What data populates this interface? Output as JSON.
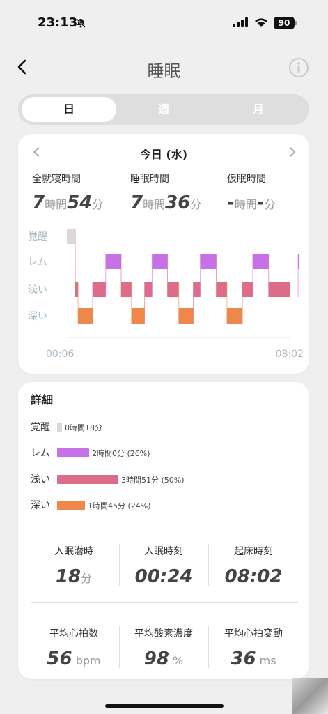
{
  "status_bar": {
    "time": "23:13",
    "battery": "90"
  },
  "nav": {
    "title": "睡眠"
  },
  "segments": [
    {
      "label": "日",
      "active": true
    },
    {
      "label": "週",
      "active": false
    },
    {
      "label": "月",
      "active": false
    }
  ],
  "summary": {
    "date": "今日 (水)",
    "total_in_bed": {
      "label": "全就寝時間",
      "hours": "7",
      "hours_unit": "時間",
      "minutes": "54",
      "minutes_unit": "分"
    },
    "sleep_time": {
      "label": "睡眠時間",
      "hours": "7",
      "hours_unit": "時間",
      "minutes": "36",
      "minutes_unit": "分"
    },
    "nap_time": {
      "label": "仮眠時間",
      "hours": "-",
      "hours_unit": "時間",
      "minutes": "-",
      "minutes_unit": "分"
    }
  },
  "chart_data": {
    "type": "hypnogram",
    "stages": [
      "覚醒",
      "レム",
      "浅い",
      "深い"
    ],
    "x_start_label": "00:06",
    "x_end_label": "08:02",
    "colors": {
      "覚醒": "#d9d9d9",
      "レム": "#c671e8",
      "浅い": "#dc6c88",
      "深い": "#ef874a"
    },
    "segments": [
      {
        "stage": "覚醒",
        "start_min": 0,
        "end_min": 18
      },
      {
        "stage": "浅い",
        "start_min": 18,
        "end_min": 24
      },
      {
        "stage": "深い",
        "start_min": 24,
        "end_min": 55
      },
      {
        "stage": "浅い",
        "start_min": 55,
        "end_min": 83
      },
      {
        "stage": "レム",
        "start_min": 83,
        "end_min": 116
      },
      {
        "stage": "浅い",
        "start_min": 116,
        "end_min": 138
      },
      {
        "stage": "深い",
        "start_min": 138,
        "end_min": 166
      },
      {
        "stage": "浅い",
        "start_min": 166,
        "end_min": 182
      },
      {
        "stage": "レム",
        "start_min": 182,
        "end_min": 215
      },
      {
        "stage": "浅い",
        "start_min": 215,
        "end_min": 239
      },
      {
        "stage": "深い",
        "start_min": 239,
        "end_min": 270
      },
      {
        "stage": "浅い",
        "start_min": 270,
        "end_min": 285
      },
      {
        "stage": "レム",
        "start_min": 285,
        "end_min": 319
      },
      {
        "stage": "浅い",
        "start_min": 319,
        "end_min": 342
      },
      {
        "stage": "深い",
        "start_min": 342,
        "end_min": 375
      },
      {
        "stage": "浅い",
        "start_min": 375,
        "end_min": 397
      },
      {
        "stage": "レム",
        "start_min": 397,
        "end_min": 431
      },
      {
        "stage": "浅い",
        "start_min": 431,
        "end_min": 494
      },
      {
        "stage": "レム",
        "start_min": 494,
        "end_min": 512
      }
    ],
    "total_minutes": 476
  },
  "detail": {
    "title": "詳細",
    "distribution": [
      {
        "label": "覚醒",
        "value": "0時間18分",
        "minutes": 18,
        "color": "#d9d9d9"
      },
      {
        "label": "レム",
        "value": "2時間0分 (26%)",
        "minutes": 120,
        "color": "#c671e8"
      },
      {
        "label": "浅い",
        "value": "3時間51分 (50%)",
        "minutes": 231,
        "color": "#dc6c88"
      },
      {
        "label": "深い",
        "value": "1時間45分 (24%)",
        "minutes": 105,
        "color": "#ef874a"
      }
    ],
    "metrics_top": [
      {
        "label": "入眠潜時",
        "value": "18",
        "unit": "分"
      },
      {
        "label": "入眠時刻",
        "value": "00:24",
        "unit": ""
      },
      {
        "label": "起床時刻",
        "value": "08:02",
        "unit": ""
      }
    ],
    "metrics_bottom": [
      {
        "label": "平均心拍数",
        "value": "56",
        "unit": "bpm"
      },
      {
        "label": "平均酸素濃度",
        "value": "98",
        "unit": "%"
      },
      {
        "label": "平均心拍変動",
        "value": "36",
        "unit": "ms"
      }
    ]
  }
}
